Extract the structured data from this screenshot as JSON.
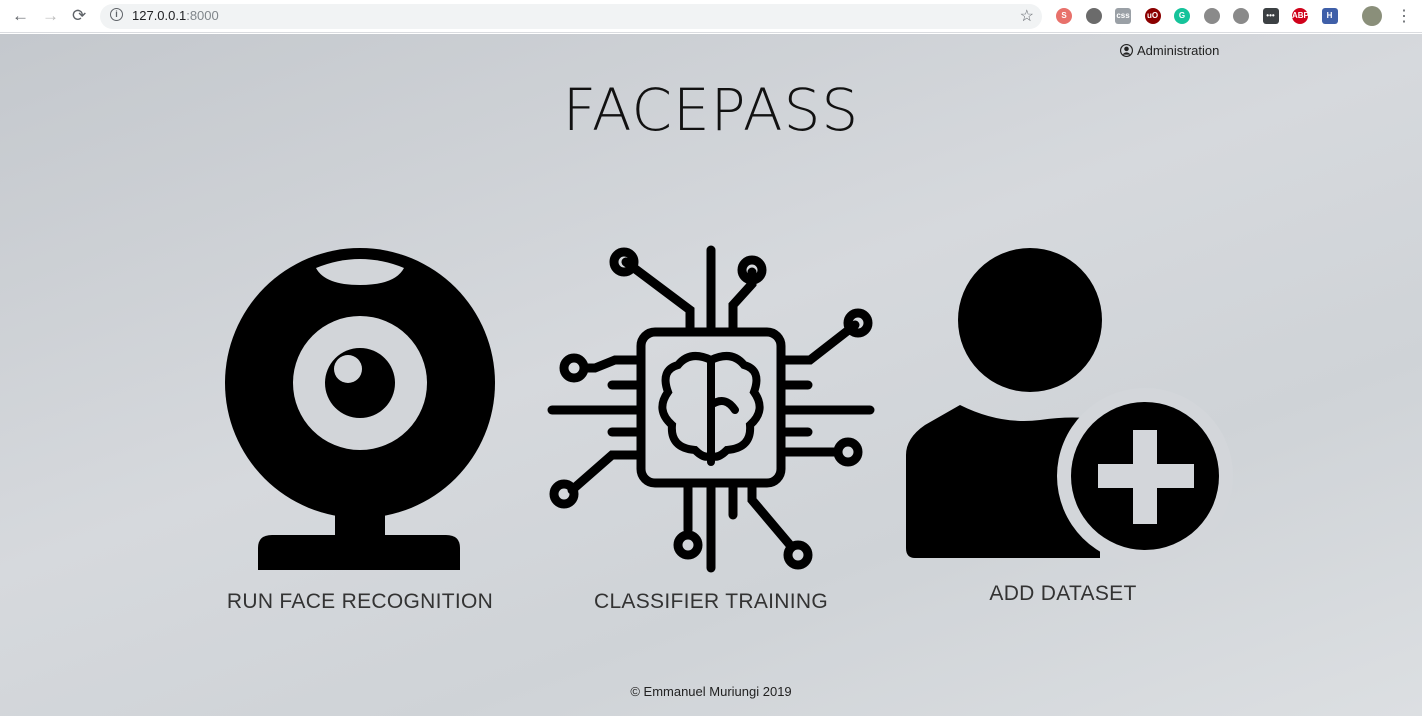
{
  "browser": {
    "url_host": "127.0.0.1",
    "url_port": ":8000",
    "back": "←",
    "forward": "→",
    "reload": "⟳",
    "star": "☆",
    "menu": "⋮",
    "extensions": [
      {
        "name": "ext-s",
        "label": "S",
        "color": "#e8716b"
      },
      {
        "name": "ext-shield",
        "label": "",
        "color": "#6b6b6b"
      },
      {
        "name": "ext-css",
        "label": "css",
        "color": "#9aa0a6"
      },
      {
        "name": "ext-ublock",
        "label": "uO",
        "color": "#8b0000"
      },
      {
        "name": "ext-grammarly",
        "label": "G",
        "color": "#15c39a"
      },
      {
        "name": "ext-camera",
        "label": "",
        "color": "#8a8a8a"
      },
      {
        "name": "ext-circle",
        "label": "",
        "color": "#8a8a8a"
      },
      {
        "name": "ext-dots",
        "label": "•••",
        "color": "#3c4043"
      },
      {
        "name": "ext-abp",
        "label": "ABP",
        "color": "#d0021b"
      },
      {
        "name": "ext-h",
        "label": "H",
        "color": "#3f5fa8"
      }
    ]
  },
  "header": {
    "admin_label": "Administration",
    "title": "FACEPASS"
  },
  "actions": [
    {
      "label": "RUN FACE RECOGNITION"
    },
    {
      "label": "CLASSIFIER TRAINING"
    },
    {
      "label": "ADD DATASET"
    }
  ],
  "footer": {
    "text": "© Emmanuel Muriungi 2019"
  }
}
